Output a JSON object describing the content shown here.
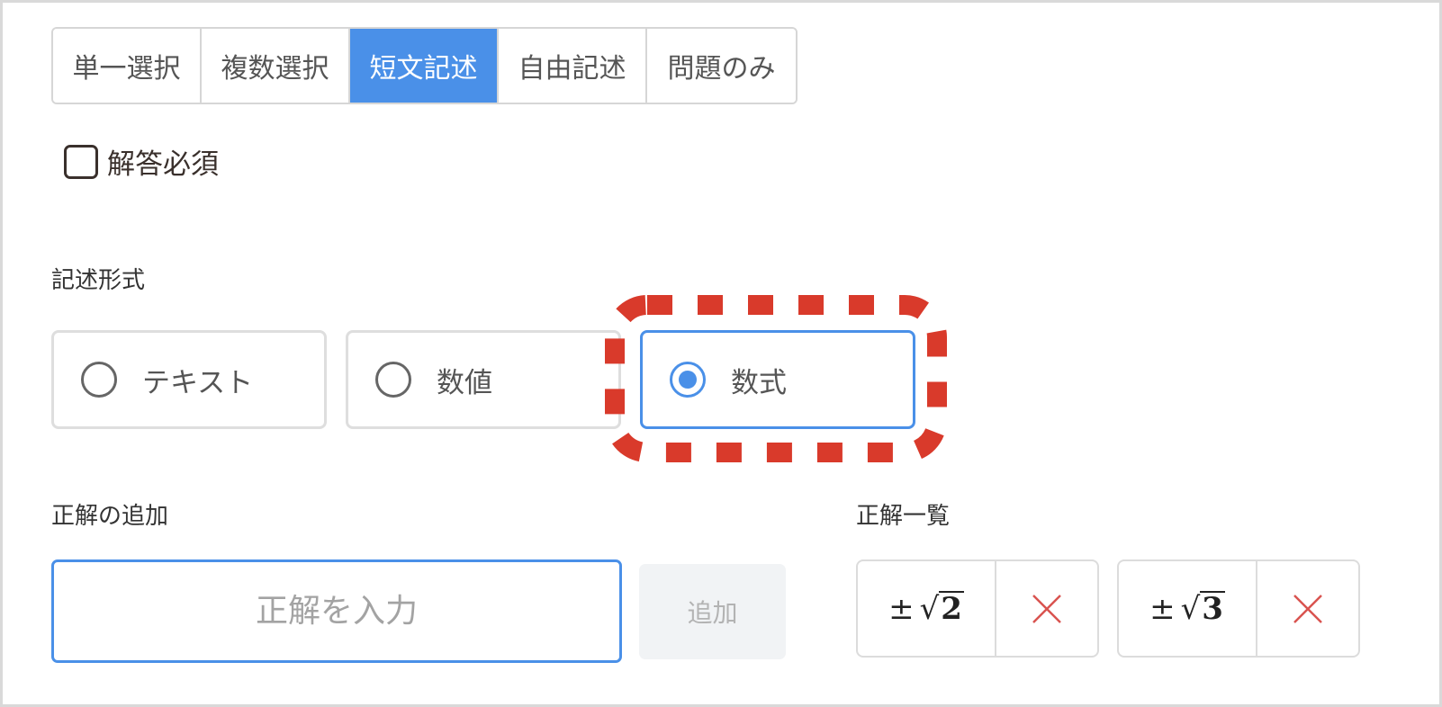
{
  "tabs": [
    {
      "label": "単一選択",
      "active": false
    },
    {
      "label": "複数選択",
      "active": false
    },
    {
      "label": "短文記述",
      "active": true
    },
    {
      "label": "自由記述",
      "active": false
    },
    {
      "label": "問題のみ",
      "active": false
    }
  ],
  "required": {
    "label": "解答必須",
    "checked": false
  },
  "format": {
    "heading": "記述形式",
    "options": [
      {
        "label": "テキスト",
        "selected": false
      },
      {
        "label": "数値",
        "selected": false
      },
      {
        "label": "数式",
        "selected": true
      }
    ]
  },
  "add_answer": {
    "heading": "正解の追加",
    "placeholder": "正解を入力",
    "button_label": "追加"
  },
  "answer_list": {
    "heading": "正解一覧",
    "items": [
      {
        "sign": "±",
        "radical": "√",
        "radicand": "2"
      },
      {
        "sign": "±",
        "radical": "√",
        "radicand": "3"
      }
    ]
  },
  "colors": {
    "accent": "#4a90e8",
    "highlight": "#d93a2b",
    "remove_icon": "#d9534f"
  }
}
